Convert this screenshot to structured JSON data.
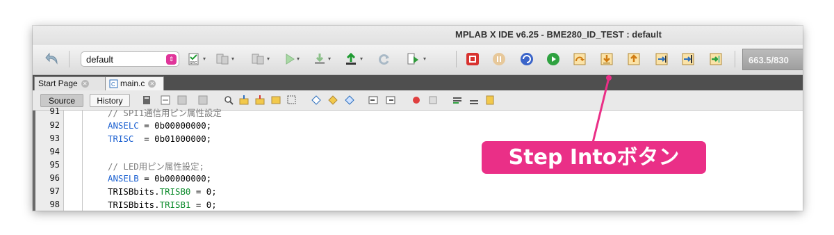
{
  "window": {
    "title": "MPLAB X IDE v6.25 - BME280_ID_TEST : default"
  },
  "toolbar": {
    "config_value": "default",
    "memory_readout": "663.5/830",
    "accent_pink": "#ea2f87",
    "icons": [
      "back-arrow-icon",
      "project-properties-icon",
      "build-config-icon",
      "make-icon",
      "run-icon",
      "program-device-icon",
      "upload-icon",
      "refresh-icon",
      "debug-main-icon",
      "finish-debug-icon",
      "pause-icon",
      "reset-icon",
      "continue-icon",
      "step-over-icon",
      "step-into-icon",
      "step-out-icon",
      "run-to-cursor-icon",
      "set-pc-icon",
      "focus-cursor-icon"
    ]
  },
  "tabs": [
    {
      "label": "Start Page"
    },
    {
      "label": "main.c"
    }
  ],
  "editor_toolbar": {
    "source_label": "Source",
    "history_label": "History"
  },
  "code": {
    "lines": [
      {
        "num": "91",
        "text": "// SPI1通信用ピン属性設定"
      },
      {
        "num": "92",
        "text": "ANSELC = 0b00000000;"
      },
      {
        "num": "93",
        "text": "TRISC  = 0b01000000;"
      },
      {
        "num": "94",
        "text": ""
      },
      {
        "num": "95",
        "text": "// LED用ピン属性設定;"
      },
      {
        "num": "96",
        "text": "ANSELB = 0b00000000;"
      },
      {
        "num": "97",
        "text": "TRISBbits.TRISB0 = 0;"
      },
      {
        "num": "98",
        "text": "TRISBbits.TRISB1 = 0;"
      }
    ]
  },
  "callout": {
    "label": "Step Intoボタン"
  }
}
